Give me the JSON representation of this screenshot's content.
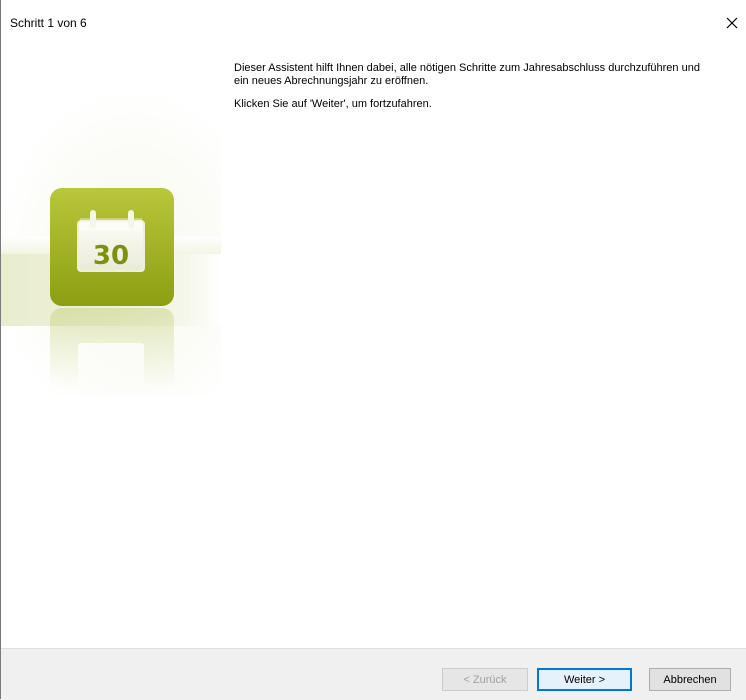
{
  "window": {
    "title": "Schritt 1 von 6",
    "close_glyph": "✕"
  },
  "sidebar": {
    "icon": "calendar-icon",
    "day_number": "30",
    "accent_color": "#9fb019"
  },
  "content": {
    "intro_text": "Dieser Assistent hilft Ihnen dabei, alle nötigen Schritte zum Jahresabschluss durchzuführen und ein neues Abrechnungsjahr zu eröffnen.",
    "instruction_text": "Klicken Sie auf 'Weiter', um fortzufahren."
  },
  "footer": {
    "back_label": "< Zurück",
    "next_label": "Weiter >",
    "cancel_label": "Abbrechen"
  }
}
